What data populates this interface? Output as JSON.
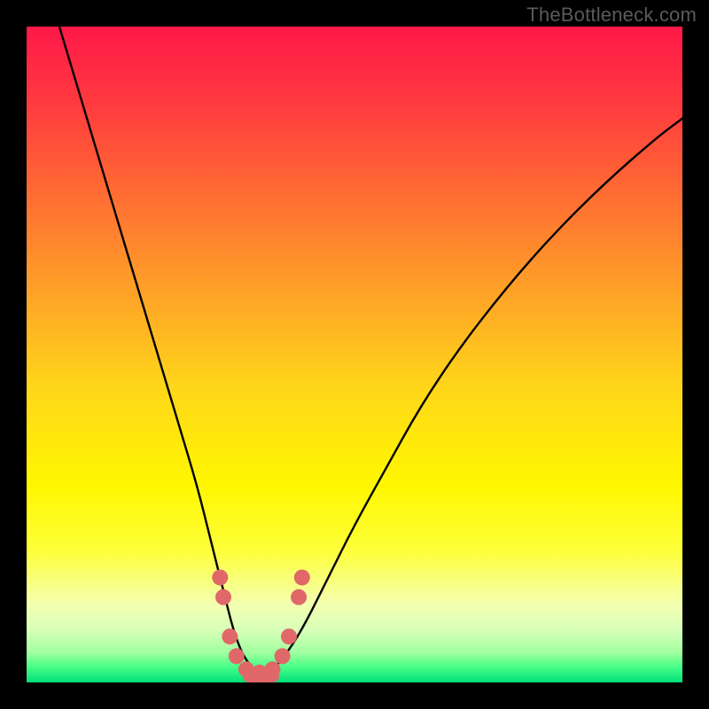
{
  "watermark": {
    "text": "TheBottleneck.com"
  },
  "gradient": {
    "stops": [
      {
        "offset": 0.0,
        "color": "#ff1848"
      },
      {
        "offset": 0.12,
        "color": "#ff3b3f"
      },
      {
        "offset": 0.25,
        "color": "#ff6a33"
      },
      {
        "offset": 0.4,
        "color": "#ffa028"
      },
      {
        "offset": 0.55,
        "color": "#ffd61a"
      },
      {
        "offset": 0.7,
        "color": "#fff700"
      },
      {
        "offset": 0.8,
        "color": "#fdff3a"
      },
      {
        "offset": 0.88,
        "color": "#f4ffb0"
      },
      {
        "offset": 0.92,
        "color": "#d8ffb8"
      },
      {
        "offset": 0.955,
        "color": "#9fff9f"
      },
      {
        "offset": 0.975,
        "color": "#4cff88"
      },
      {
        "offset": 1.0,
        "color": "#00e07a"
      }
    ]
  },
  "chart_data": {
    "type": "line",
    "title": "",
    "xlabel": "",
    "ylabel": "",
    "xlim": [
      0,
      100
    ],
    "ylim": [
      0,
      100
    ],
    "series": [
      {
        "name": "bottleneck-curve",
        "x": [
          5,
          8,
          11,
          14,
          17,
          20,
          23,
          26,
          28,
          30,
          31.5,
          33,
          35,
          37,
          39,
          42,
          46,
          50,
          55,
          60,
          66,
          73,
          80,
          88,
          96,
          100
        ],
        "y": [
          100,
          90,
          80,
          70,
          60,
          50,
          40,
          30,
          22,
          14,
          8,
          4,
          1.5,
          1.5,
          3.5,
          8,
          16,
          24,
          33,
          42,
          51,
          60,
          68,
          76,
          83,
          86
        ]
      }
    ],
    "markers": {
      "name": "highlight-dots",
      "color": "#e06868",
      "radius_px": 9,
      "points": [
        {
          "x": 29.5,
          "y": 16
        },
        {
          "x": 30.0,
          "y": 13
        },
        {
          "x": 31.0,
          "y": 7
        },
        {
          "x": 32.0,
          "y": 4
        },
        {
          "x": 33.5,
          "y": 2
        },
        {
          "x": 35.5,
          "y": 1.5
        },
        {
          "x": 37.5,
          "y": 2
        },
        {
          "x": 39.0,
          "y": 4
        },
        {
          "x": 40.0,
          "y": 7
        },
        {
          "x": 41.5,
          "y": 13
        },
        {
          "x": 42.0,
          "y": 16
        }
      ]
    },
    "bottom_bar": {
      "color": "#e06868",
      "x_start": 33,
      "x_end": 38.5,
      "height_pct": 1.8
    }
  }
}
